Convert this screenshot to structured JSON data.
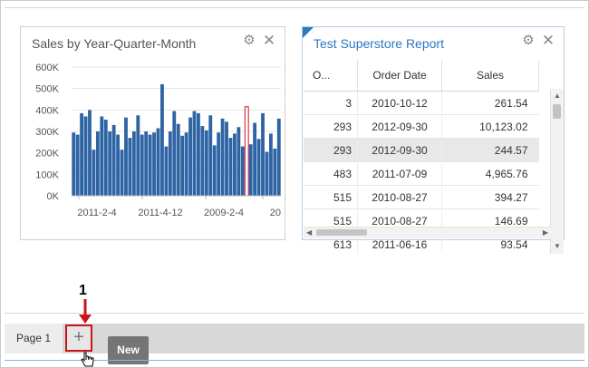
{
  "chart_widget": {
    "title": "Sales by Year-Quarter-Month",
    "gear_glyph": "⚙",
    "close_glyph": "✕"
  },
  "chart_data": {
    "type": "bar",
    "title": "Sales by Year-Quarter-Month",
    "xlabel": "",
    "ylabel": "",
    "ylim": [
      0,
      600000
    ],
    "y_ticks": [
      "0K",
      "100K",
      "200K",
      "300K",
      "400K",
      "500K",
      "600K"
    ],
    "x_tick_labels": [
      "2011-2-4",
      "2011-4-12",
      "2009-2-4",
      "20"
    ],
    "grid": true,
    "bar_color": "#2e64a4",
    "highlight_color": "#c8171c",
    "highlight_index": 43,
    "values": [
      295000,
      285000,
      385000,
      370000,
      400000,
      215000,
      300000,
      370000,
      355000,
      300000,
      330000,
      285000,
      215000,
      365000,
      270000,
      300000,
      375000,
      285000,
      300000,
      285000,
      295000,
      315000,
      520000,
      230000,
      300000,
      395000,
      335000,
      280000,
      295000,
      365000,
      395000,
      385000,
      325000,
      305000,
      375000,
      235000,
      295000,
      360000,
      345000,
      270000,
      290000,
      320000,
      230000,
      415000,
      240000,
      340000,
      265000,
      385000,
      205000,
      290000,
      220000,
      360000
    ]
  },
  "table_widget": {
    "title": "Test Superstore Report",
    "gear_glyph": "⚙",
    "close_glyph": "✕",
    "columns": [
      "O...",
      "Order Date",
      "Sales"
    ],
    "rows": [
      {
        "id": "3",
        "date": "2010-10-12",
        "sales": "261.54"
      },
      {
        "id": "293",
        "date": "2012-09-30",
        "sales": "10,123.02"
      },
      {
        "id": "293",
        "date": "2012-09-30",
        "sales": "244.57"
      },
      {
        "id": "483",
        "date": "2011-07-09",
        "sales": "4,965.76"
      },
      {
        "id": "515",
        "date": "2010-08-27",
        "sales": "394.27"
      },
      {
        "id": "515",
        "date": "2010-08-27",
        "sales": "146.69"
      },
      {
        "id": "613",
        "date": "2011-06-16",
        "sales": "93.54"
      }
    ],
    "selected_row": 2
  },
  "tabs": {
    "page_label": "Page 1",
    "add_glyph": "+",
    "tooltip": "New"
  },
  "callout": {
    "number": "1",
    "color": "#c8171c"
  }
}
